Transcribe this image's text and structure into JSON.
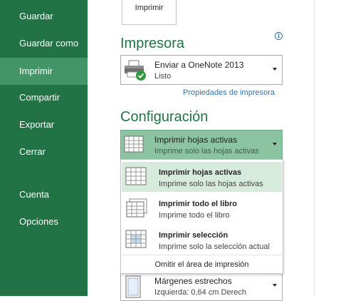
{
  "nav": {
    "items": [
      {
        "label": "Guardar",
        "active": false
      },
      {
        "label": "Guardar como",
        "active": false
      },
      {
        "label": "Imprimir",
        "active": true
      },
      {
        "label": "Compartir",
        "active": false
      },
      {
        "label": "Exportar",
        "active": false
      },
      {
        "label": "Cerrar",
        "active": false
      },
      {
        "label": "Cuenta",
        "active": false
      },
      {
        "label": "Opciones",
        "active": false
      }
    ]
  },
  "print_button": {
    "label": "Imprimir"
  },
  "printer": {
    "section_title": "Impresora",
    "name": "Enviar a OneNote 2013",
    "status": "Listo",
    "properties_link": "Propiedades de impresora"
  },
  "settings": {
    "section_title": "Configuración",
    "selected": {
      "title": "Imprimir hojas activas",
      "subtitle": "Imprime solo las hojas activas"
    },
    "menu": {
      "items": [
        {
          "title": "Imprimir hojas activas",
          "subtitle": "Imprime solo las hojas activas",
          "highlighted": true
        },
        {
          "title": "Imprimir todo el libro",
          "subtitle": "Imprime todo el libro",
          "highlighted": false
        },
        {
          "title": "Imprimir selección",
          "subtitle": "Imprime solo la selección actual",
          "highlighted": false
        }
      ],
      "footer": "Omitir el área de impresión"
    },
    "margins": {
      "title": "Márgenes estrechos",
      "subtitle": "Izquierda: 0,64 cm    Derech"
    }
  },
  "colors": {
    "nav_bg": "#217346",
    "nav_active": "#439467",
    "accent": "#217346",
    "link": "#2e75b6",
    "menu_highlight": "#d7ebdd"
  }
}
